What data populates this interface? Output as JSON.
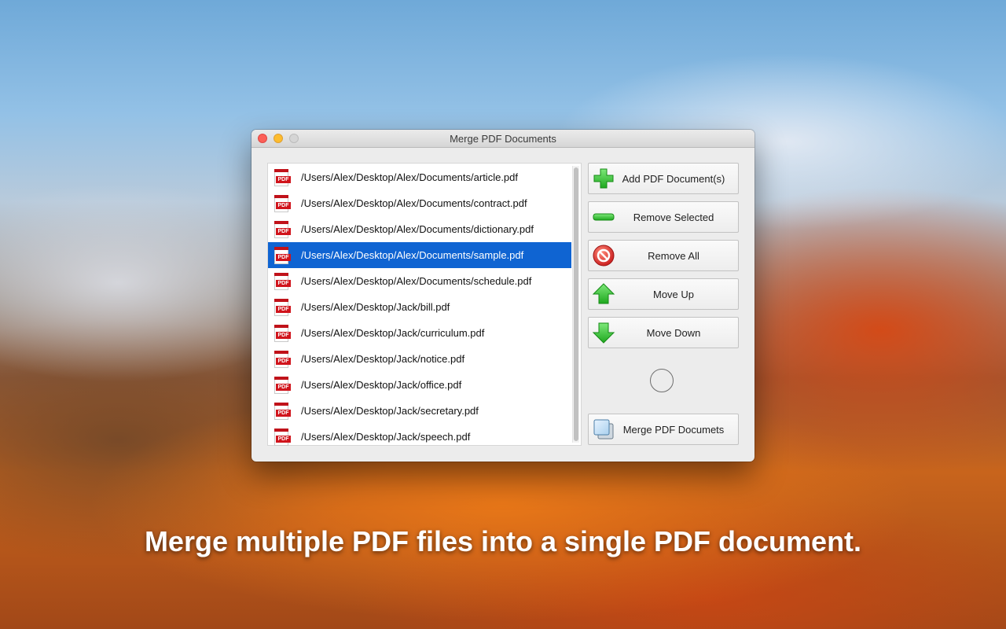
{
  "window": {
    "title": "Merge PDF Documents"
  },
  "files": {
    "icon_tag": "PDF",
    "items": [
      "/Users/Alex/Desktop/Alex/Documents/article.pdf",
      "/Users/Alex/Desktop/Alex/Documents/contract.pdf",
      "/Users/Alex/Desktop/Alex/Documents/dictionary.pdf",
      "/Users/Alex/Desktop/Alex/Documents/sample.pdf",
      "/Users/Alex/Desktop/Alex/Documents/schedule.pdf",
      "/Users/Alex/Desktop/Jack/bill.pdf",
      "/Users/Alex/Desktop/Jack/curriculum.pdf",
      "/Users/Alex/Desktop/Jack/notice.pdf",
      "/Users/Alex/Desktop/Jack/office.pdf",
      "/Users/Alex/Desktop/Jack/secretary.pdf",
      "/Users/Alex/Desktop/Jack/speech.pdf"
    ],
    "selected_index": 3
  },
  "buttons": {
    "add": "Add PDF Document(s)",
    "remove_selected": "Remove Selected",
    "remove_all": "Remove All",
    "move_up": "Move Up",
    "move_down": "Move Down",
    "merge": "Merge PDF Documets"
  },
  "caption": "Merge multiple PDF files into a single PDF document.",
  "colors": {
    "selection": "#0f64d2",
    "green_icon": "#3cc83c",
    "red_icon": "#e5322d"
  },
  "icons": {
    "add": "green-plus-icon",
    "remove_selected": "green-minus-icon",
    "remove_all": "red-prohibited-icon",
    "move_up": "green-up-arrow-icon",
    "move_down": "green-down-arrow-icon",
    "merge": "stacked-documents-icon"
  }
}
